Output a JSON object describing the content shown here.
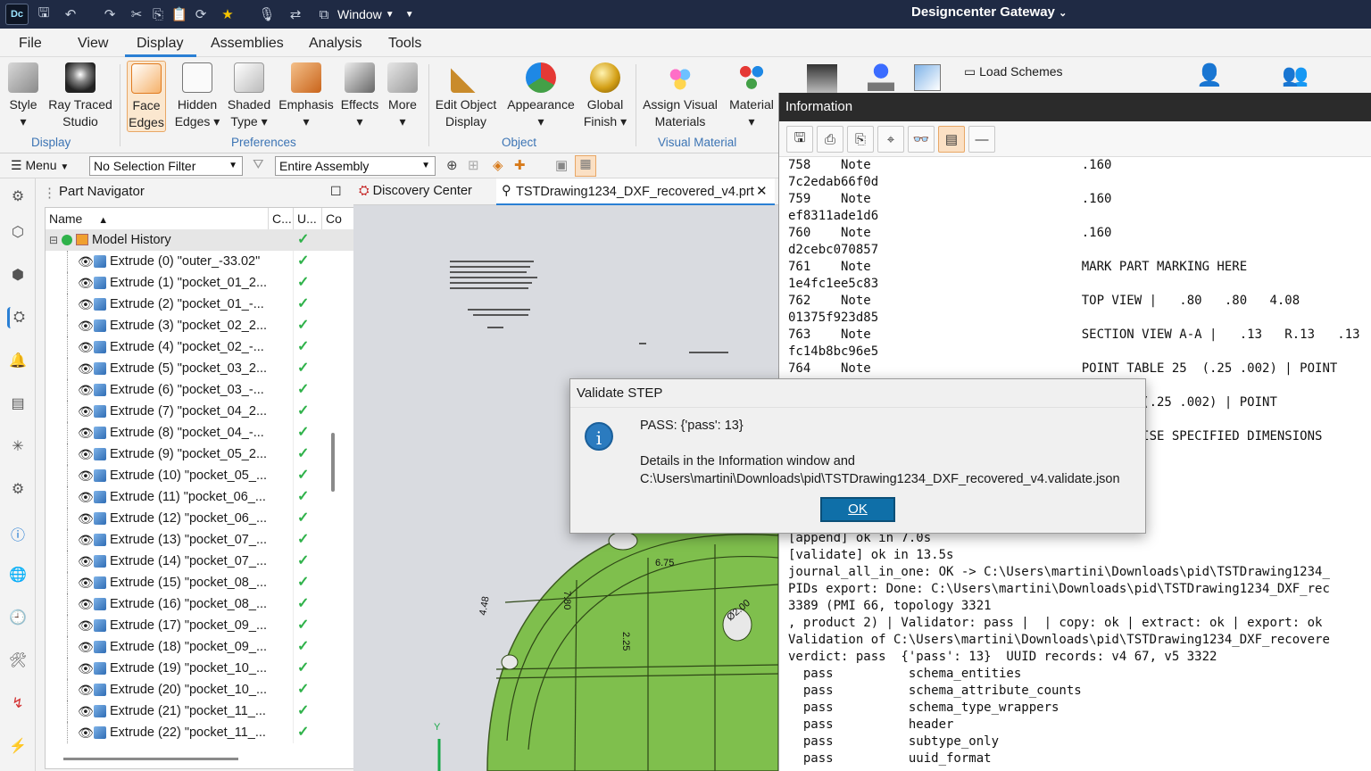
{
  "app": {
    "logo": "Dc",
    "title": "Designcenter  Gateway",
    "window_menu": "Window"
  },
  "menu": {
    "tabs": [
      "File",
      "View",
      "Display",
      "Assemblies",
      "Analysis",
      "Tools"
    ],
    "active": "Display"
  },
  "ribbon": {
    "buttons": [
      {
        "l1": "Style",
        "l2": "▾",
        "icon": "cube-icon"
      },
      {
        "l1": "Ray Traced",
        "l2": "Studio",
        "icon": "teapot-icon"
      },
      {
        "l1": "Face",
        "l2": "Edges",
        "icon": "face-edges-icon"
      },
      {
        "l1": "Hidden",
        "l2": "Edges ▾",
        "icon": "hidden-edges-icon"
      },
      {
        "l1": "Shaded",
        "l2": "Type ▾",
        "icon": "shaded-type-icon"
      },
      {
        "l1": "Emphasis",
        "l2": "▾",
        "icon": "emphasis-icon"
      },
      {
        "l1": "Effects",
        "l2": "▾",
        "icon": "effects-icon"
      },
      {
        "l1": "More",
        "l2": "▾",
        "icon": "more-icon"
      },
      {
        "l1": "Edit Object",
        "l2": "Display",
        "icon": "brush-icon"
      },
      {
        "l1": "Appearance",
        "l2": "▾",
        "icon": "color-wheel-icon"
      },
      {
        "l1": "Global",
        "l2": "Finish ▾",
        "icon": "gold-sphere-icon"
      },
      {
        "l1": "Assign Visual",
        "l2": "Materials",
        "icon": "materials-icon"
      },
      {
        "l1": "Material",
        "l2": "▾",
        "icon": "material-icon"
      }
    ],
    "groups": [
      "Display",
      "Preferences",
      "Object",
      "Visual Material"
    ],
    "load_schemes": "Load Schemes"
  },
  "toolbar": {
    "menu": "Menu",
    "selection_filter": "No Selection Filter",
    "scope": "Entire Assembly"
  },
  "navigator": {
    "title": "Part Navigator",
    "columns": [
      "Name",
      "C...",
      "U...",
      "Co"
    ],
    "root": "Model History",
    "rows": [
      "Extrude (0) \"outer_-33.02\"",
      "Extrude (1) \"pocket_01_2...",
      "Extrude (2) \"pocket_01_-...",
      "Extrude (3) \"pocket_02_2...",
      "Extrude (4) \"pocket_02_-...",
      "Extrude (5) \"pocket_03_2...",
      "Extrude (6) \"pocket_03_-...",
      "Extrude (7) \"pocket_04_2...",
      "Extrude (8) \"pocket_04_-...",
      "Extrude (9) \"pocket_05_2...",
      "Extrude (10) \"pocket_05_...",
      "Extrude (11) \"pocket_06_...",
      "Extrude (12) \"pocket_06_...",
      "Extrude (13) \"pocket_07_...",
      "Extrude (14) \"pocket_07_...",
      "Extrude (15) \"pocket_08_...",
      "Extrude (16) \"pocket_08_...",
      "Extrude (17) \"pocket_09_...",
      "Extrude (18) \"pocket_09_...",
      "Extrude (19) \"pocket_10_...",
      "Extrude (20) \"pocket_10_...",
      "Extrude (21) \"pocket_11_...",
      "Extrude (22) \"pocket_11_..."
    ]
  },
  "graphics": {
    "tabs": [
      "Discovery Center",
      "TSTDrawing1234_DXF_recovered_v4.prt"
    ],
    "dims": [
      "6.75",
      "7.80",
      "4.48",
      "2.25",
      "Ø2.00"
    ],
    "axis": "Y"
  },
  "info": {
    "title": "Information",
    "lines": [
      "758    Note                            .160",
      "7c2edab66f0d",
      "759    Note                            .160",
      "ef8311ade1d6",
      "760    Note                            .160",
      "d2cebc070857",
      "761    Note                            MARK PART MARKING HERE",
      "1e4fc1ee5c83",
      "762    Note                            TOP VIEW |   .80   .80   4.08",
      "01375f923d85",
      "763    Note                            SECTION VIEW A-A |   .13   R.13   .13",
      "fc14b8bc96e5",
      "764    Note                            POINT TABLE 25  (.25 .002) | POINT",
      "",
      "                                          BLE  (.25 .002) | POINT",
      "",
      "                                          THERWISE SPECIFIED DIMENSIONS",
      "",
      "",
      "",
      "",
      "",
      "[append] ok in 7.0s",
      "[validate] ok in 13.5s",
      "journal_all_in_one: OK -> C:\\Users\\martini\\Downloads\\pid\\TSTDrawing1234_",
      "PIDs export: Done: C:\\Users\\martini\\Downloads\\pid\\TSTDrawing1234_DXF_rec",
      "3389 (PMI 66, topology 3321",
      ", product 2) | Validator: pass |  | copy: ok | extract: ok | export: ok",
      "Validation of C:\\Users\\martini\\Downloads\\pid\\TSTDrawing1234_DXF_recovere",
      "verdict: pass  {'pass': 13}  UUID records: v4 67, v5 3322",
      "  pass          schema_entities",
      "  pass          schema_attribute_counts",
      "  pass          schema_type_wrappers",
      "  pass          header",
      "  pass          subtype_only",
      "  pass          uuid_format"
    ]
  },
  "dialog": {
    "title": "Validate STEP",
    "line1": "PASS: {'pass': 13}",
    "line2": "Details in the Information window and",
    "line3": "C:\\Users\\martini\\Downloads\\pid\\TSTDrawing1234_DXF_recovered_v4.validate.json",
    "ok": "OK"
  }
}
